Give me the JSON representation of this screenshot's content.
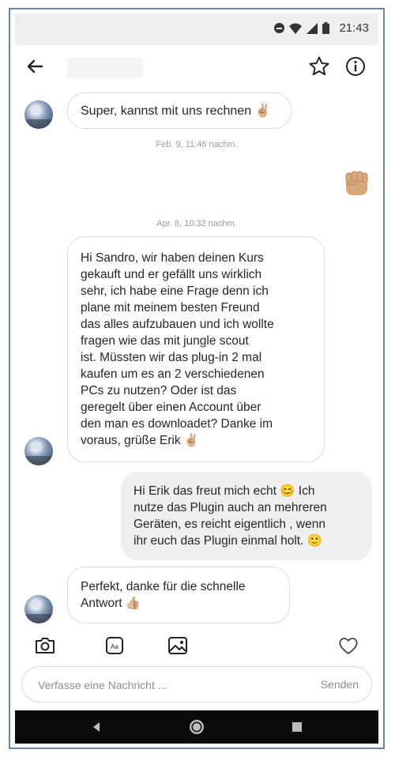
{
  "status_bar": {
    "time": "21:43"
  },
  "header": {
    "contact_name": ""
  },
  "messages": [
    {
      "type": "in",
      "text": "Super, kannst mit uns rechnen ✌🏼"
    },
    {
      "type": "timestamp",
      "text": "Feb. 9, 11:46 nachm."
    },
    {
      "type": "out-emoji",
      "text": "✊🏼"
    },
    {
      "type": "timestamp",
      "text": "Apr. 8, 10:32 nachm."
    },
    {
      "type": "in",
      "lines": [
        "Hi Sandro, wir haben deinen Kurs",
        "gekauft und er gefällt uns wirklich",
        "sehr, ich habe eine Frage denn ich",
        "plane mit meinem besten Freund",
        "das alles aufzubauen und ich wollte",
        "fragen wie das mit jungle scout",
        "ist. Müssten wir das plug-in 2 mal",
        "kaufen um es an 2 verschiedenen",
        "PCs zu nutzen?  Oder ist das",
        "geregelt über einen Account über",
        "den man es downloadet? Danke im",
        "voraus, grüße Erik ✌🏼"
      ]
    },
    {
      "type": "out",
      "lines": [
        "Hi Erik das freut mich echt 😊 Ich",
        "nutze das Plugin auch an mehreren",
        "Geräten, es reicht eigentlich , wenn",
        "ihr euch das Plugin einmal holt. 🙂"
      ]
    },
    {
      "type": "in",
      "lines": [
        "Perfekt, danke für die schnelle",
        "Antwort 👍🏼"
      ]
    }
  ],
  "composer": {
    "placeholder": "Verfasse eine Nachricht ...",
    "send_label": "Senden"
  },
  "icons": {
    "back": "arrow-left-icon",
    "star": "star-icon",
    "info": "info-icon",
    "camera": "camera-icon",
    "sticker": "sticker-icon",
    "gallery": "gallery-icon",
    "heart": "heart-icon"
  },
  "colors": {
    "accent_skin": "#d8a878",
    "bubble_out": "#efefef",
    "bubble_border": "#dcdcdc"
  }
}
